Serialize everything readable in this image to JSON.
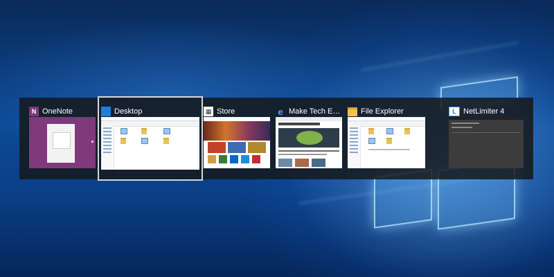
{
  "task_switcher": {
    "items": [
      {
        "title": "OneNote",
        "icon": "onenote-icon",
        "color": "#80397b"
      },
      {
        "title": "Desktop",
        "icon": "desktop-icon",
        "color": "#1e7fd8",
        "selected": true
      },
      {
        "title": "Store",
        "icon": "store-icon",
        "color": "#ffffff"
      },
      {
        "title": "Make Tech Easier - Co...",
        "icon": "edge-icon",
        "color": "#1e78d6"
      },
      {
        "title": "File Explorer",
        "icon": "file-explorer-icon",
        "color": "#f2c14e"
      },
      {
        "title": "NetLimiter 4",
        "icon": "netlimiter-icon",
        "color": "#3a8fd8"
      }
    ]
  },
  "colors": {
    "switcher_background": "#16181c",
    "onenote_purple": "#80397b",
    "wallpaper_blue": "#0c4a96"
  }
}
